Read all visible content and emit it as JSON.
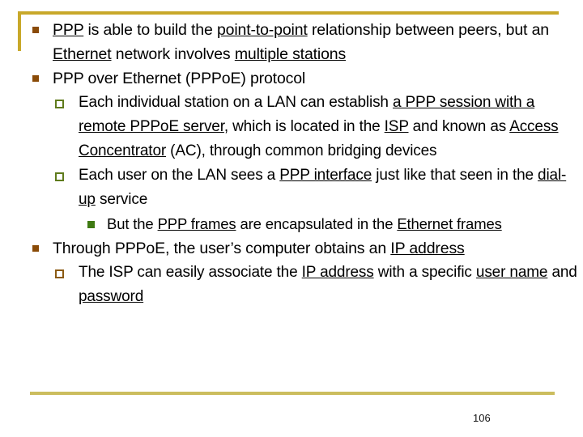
{
  "slide": {
    "page_number": "106",
    "colors": {
      "frame_top_left": "#c8a82a",
      "frame_bottom": "#cbbd5e",
      "bullet_level1": "#8a4b08",
      "bullet_level2_green": "#5f7b1c",
      "bullet_level2_brown": "#8a5a12",
      "bullet_level3": "#3f7a12",
      "text": "#000000",
      "background": "#ffffff"
    },
    "bullets": [
      {
        "level": 1,
        "bullet_style": "filled-square-brown",
        "segments": [
          {
            "text": "PPP",
            "underline": true
          },
          {
            "text": " is able to build the ",
            "underline": false
          },
          {
            "text": "point-to-point",
            "underline": true
          },
          {
            "text": " relationship between peers, but an ",
            "underline": false
          },
          {
            "text": "Ethernet",
            "underline": true
          },
          {
            "text": " network involves ",
            "underline": false
          },
          {
            "text": "multiple stations",
            "underline": true
          }
        ]
      },
      {
        "level": 1,
        "bullet_style": "filled-square-brown",
        "segments": [
          {
            "text": "PPP over Ethernet (PPPoE) protocol",
            "underline": false
          }
        ]
      },
      {
        "level": 2,
        "bullet_style": "hollow-square-green",
        "segments": [
          {
            "text": "Each individual station on a LAN can establish ",
            "underline": false
          },
          {
            "text": "a PPP session with a remote PPPoE server",
            "underline": true
          },
          {
            "text": ", which is located in the ",
            "underline": false
          },
          {
            "text": "ISP",
            "underline": true
          },
          {
            "text": " and known as ",
            "underline": false
          },
          {
            "text": "Access Concentrator",
            "underline": true
          },
          {
            "text": " (AC), through common bridging devices",
            "underline": false
          }
        ]
      },
      {
        "level": 2,
        "bullet_style": "hollow-square-green",
        "segments": [
          {
            "text": "Each user on the LAN sees a ",
            "underline": false
          },
          {
            "text": "PPP interface",
            "underline": true
          },
          {
            "text": " just like that seen in the ",
            "underline": false
          },
          {
            "text": "dial-up",
            "underline": true
          },
          {
            "text": " service",
            "underline": false
          }
        ]
      },
      {
        "level": 3,
        "bullet_style": "filled-square-green",
        "segments": [
          {
            "text": "But the ",
            "underline": false
          },
          {
            "text": "PPP frames",
            "underline": true
          },
          {
            "text": " are encapsulated in the ",
            "underline": false
          },
          {
            "text": "Ethernet frames",
            "underline": true
          }
        ]
      },
      {
        "level": 1,
        "bullet_style": "filled-square-brown",
        "segments": [
          {
            "text": "Through PPPoE, the user’s computer obtains an ",
            "underline": false
          },
          {
            "text": "IP address",
            "underline": true
          }
        ]
      },
      {
        "level": 2,
        "bullet_style": "hollow-square-brown",
        "segments": [
          {
            "text": "The ISP can easily associate the ",
            "underline": false
          },
          {
            "text": "IP address",
            "underline": true
          },
          {
            "text": " with a specific ",
            "underline": false
          },
          {
            "text": "user name",
            "underline": true
          },
          {
            "text": " and ",
            "underline": false
          },
          {
            "text": "password",
            "underline": true
          }
        ]
      }
    ]
  }
}
